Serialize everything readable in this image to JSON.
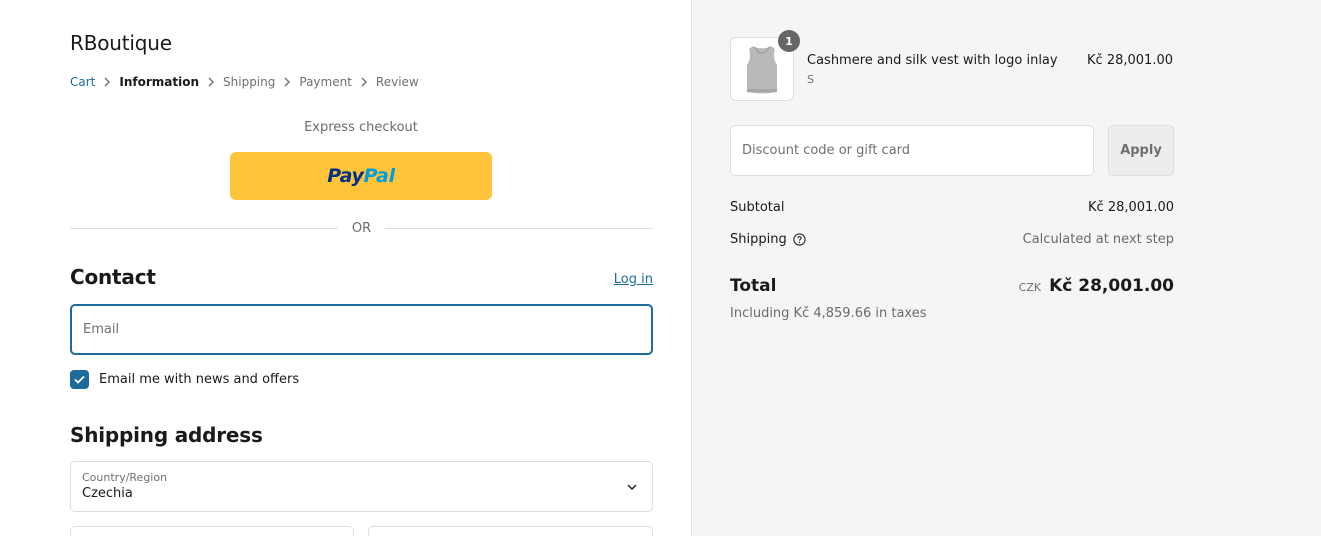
{
  "shop": {
    "name": "RBoutique"
  },
  "breadcrumb": {
    "items": [
      {
        "label": "Cart"
      },
      {
        "label": "Information"
      },
      {
        "label": "Shipping"
      },
      {
        "label": "Payment"
      },
      {
        "label": "Review"
      }
    ]
  },
  "express": {
    "label": "Express checkout",
    "paypal_part1": "Pay",
    "paypal_part2": "Pal",
    "button_color": "#ffc439"
  },
  "divider": {
    "or_label": "OR"
  },
  "contact": {
    "title": "Contact",
    "login_link": "Log in",
    "email_placeholder": "Email",
    "email_value": "",
    "newsletter_label": "Email me with news and offers",
    "newsletter_checked": true
  },
  "shipping_address": {
    "title": "Shipping address",
    "country_caption": "Country/Region",
    "country_value": "Czechia"
  },
  "order": {
    "item": {
      "quantity": "1",
      "name": "Cashmere and silk vest with logo inlay",
      "variant": "S",
      "price": "Kč 28,001.00"
    },
    "discount_placeholder": "Discount code or gift card",
    "apply_label": "Apply",
    "subtotal_label": "Subtotal",
    "subtotal_value": "Kč 28,001.00",
    "shipping_label": "Shipping",
    "shipping_value": "Calculated at next step",
    "total_label": "Total",
    "currency_code": "CZK",
    "total_value": "Kč 28,001.00",
    "tax_note": "Including Kč 4,859.66 in taxes"
  },
  "colors": {
    "accent": "#1c6b9c",
    "summary_bg": "#f5f5f5",
    "paypal_yellow": "#ffc439"
  }
}
